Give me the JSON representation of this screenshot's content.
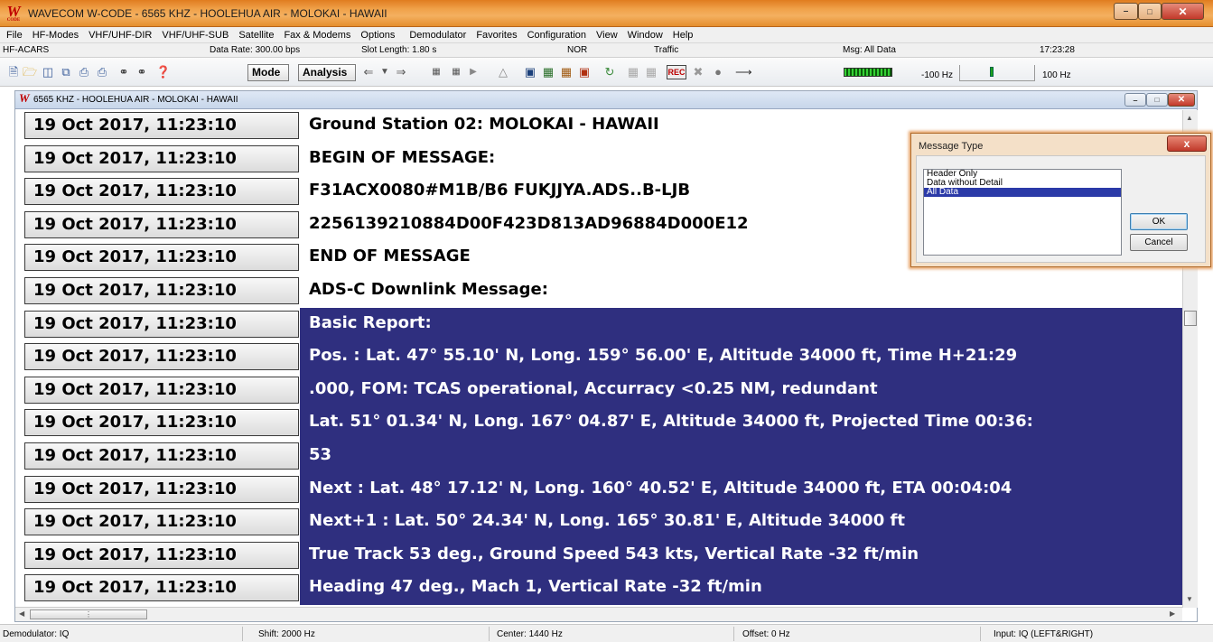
{
  "window": {
    "title": "WAVECOM W-CODE - 6565 KHZ - HOOLEHUA AIR - MOLOKAI - HAWAII",
    "icon_text": "W",
    "icon_subtext": "CODE"
  },
  "menu": [
    "File",
    "HF-Modes",
    "VHF/UHF-DIR",
    "VHF/UHF-SUB",
    "Satellite",
    "Fax & Modems",
    "Options",
    "Demodulator",
    "Favorites",
    "Configuration",
    "View",
    "Window",
    "Help"
  ],
  "info_bar": {
    "mode": "HF-ACARS",
    "data_rate": "Data Rate: 300.00 bps",
    "slot_length": "Slot Length: 1.80 s",
    "nor": "NOR",
    "traffic": "Traffic",
    "msg": "Msg: All Data",
    "time": "17:23:28"
  },
  "toolbar": {
    "mode_label": "Mode",
    "analysis_label": "Analysis",
    "freq_low": "-100 Hz",
    "freq_high": "100 Hz"
  },
  "child_window": {
    "title": "6565 KHZ - HOOLEHUA AIR - MOLOKAI - HAWAII"
  },
  "rows": [
    {
      "time": "19 Oct 2017, 11:23:10",
      "text": "Ground Station 02: MOLOKAI - HAWAII",
      "selected": false
    },
    {
      "time": "19 Oct 2017, 11:23:10",
      "text": "BEGIN OF MESSAGE:",
      "selected": false
    },
    {
      "time": "19 Oct 2017, 11:23:10",
      "text": "F31ACX0080#M1B/B6 FUKJJYA.ADS..B-LJB",
      "selected": false
    },
    {
      "time": "19 Oct 2017, 11:23:10",
      "text": "2256139210884D00F423D813AD96884D000E12",
      "selected": false
    },
    {
      "time": "19 Oct 2017, 11:23:10",
      "text": "END OF MESSAGE",
      "selected": false
    },
    {
      "time": "19 Oct 2017, 11:23:10",
      "text": "ADS-C Downlink Message:",
      "selected": false
    },
    {
      "time": "19 Oct 2017, 11:23:10",
      "text": "Basic Report:",
      "selected": true
    },
    {
      "time": "19 Oct 2017, 11:23:10",
      "text": "Pos.   : Lat. 47° 55.10' N, Long. 159° 56.00' E, Altitude 34000 ft, Time H+21:29",
      "selected": true
    },
    {
      "time": "19 Oct 2017, 11:23:10",
      "text": ".000, FOM: TCAS operational, Accurracy <0.25 NM, redundant",
      "selected": true
    },
    {
      "time": "19 Oct 2017, 11:23:10",
      "text": "Lat. 51° 01.34' N, Long. 167° 04.87' E, Altitude 34000 ft, Projected Time 00:36:",
      "selected": true
    },
    {
      "time": "19 Oct 2017, 11:23:10",
      "text": "53",
      "selected": true
    },
    {
      "time": "19 Oct 2017, 11:23:10",
      "text": "Next   : Lat. 48° 17.12' N, Long. 160° 40.52' E, Altitude 34000 ft, ETA 00:04:04",
      "selected": true
    },
    {
      "time": "19 Oct 2017, 11:23:10",
      "text": "Next+1 : Lat. 50° 24.34' N, Long. 165° 30.81' E, Altitude 34000 ft",
      "selected": true
    },
    {
      "time": "19 Oct 2017, 11:23:10",
      "text": "True Track 53 deg., Ground Speed 543 kts, Vertical Rate -32 ft/min",
      "selected": true
    },
    {
      "time": "19 Oct 2017, 11:23:10",
      "text": "Heading 47 deg., Mach 1, Vertical Rate -32 ft/min",
      "selected": true
    }
  ],
  "dialog": {
    "title": "Message Type",
    "close_label": "x",
    "options": [
      {
        "label": "Header Only",
        "selected": false
      },
      {
        "label": "Data without Detail",
        "selected": false
      },
      {
        "label": "All Data",
        "selected": true
      }
    ],
    "ok_label": "OK",
    "cancel_label": "Cancel"
  },
  "status_bar": {
    "demodulator": "Demodulator: IQ",
    "shift": "Shift: 2000 Hz",
    "center": "Center: 1440 Hz",
    "offset": "Offset: 0 Hz",
    "input": "Input: IQ (LEFT&RIGHT)"
  },
  "colors": {
    "title_bar": "#f0a24a",
    "selection": "#2f2f7f",
    "list_selection": "#2b3aa8"
  },
  "icons": [
    "new-icon",
    "open-icon",
    "save-icon",
    "copy-icon",
    "print-icon",
    "find-icon",
    "help-icon",
    "arrow-left-icon",
    "arrow-down-icon",
    "arrow-right-icon",
    "rec-icon",
    "level-meter-icon"
  ]
}
